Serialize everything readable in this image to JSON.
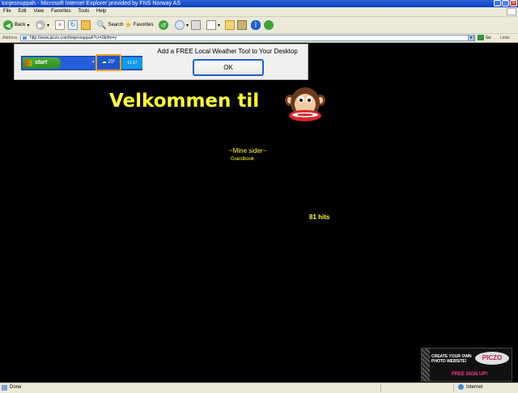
{
  "window": {
    "title": "tonjesnuppah - Microsoft Internet Explorer provided by FNS Norway AS",
    "controls": [
      "_",
      "□",
      "×"
    ]
  },
  "menubar": {
    "items": [
      "File",
      "Edit",
      "View",
      "Favorites",
      "Tools",
      "Help"
    ]
  },
  "toolbar": {
    "back_label": "Back",
    "search_label": "Search",
    "favorites_label": "Favorites"
  },
  "address": {
    "label": "Address",
    "url": "http://www.piczo.com/tonjesnuppah?cr=2&rfm=y",
    "go_label": "Go",
    "links_label": "Links"
  },
  "weather_ad": {
    "start_label": "start",
    "temperature": "20°",
    "clock": "11:17",
    "message": "Add a FREE Local Weather Tool to Your Desktop",
    "ok_label": "OK"
  },
  "page": {
    "heading": "Velkommen til",
    "nav_title": "~Mine sider~",
    "guestbook_link": "Guestbook",
    "hits": "81 hits"
  },
  "piczo_ad": {
    "line1": "CREATE YOUR OWN",
    "line2": "PHOTO WEBSITE!",
    "logo": "PICZO",
    "signup": "FREE SIGN UP!"
  },
  "statusbar": {
    "status": "Done",
    "zone": "Internet"
  },
  "colors": {
    "page_bg": "#000000",
    "heading_yellow": "#ffff33",
    "chrome": "#ece9d8",
    "titlebar_blue": "#0a3fbf"
  }
}
